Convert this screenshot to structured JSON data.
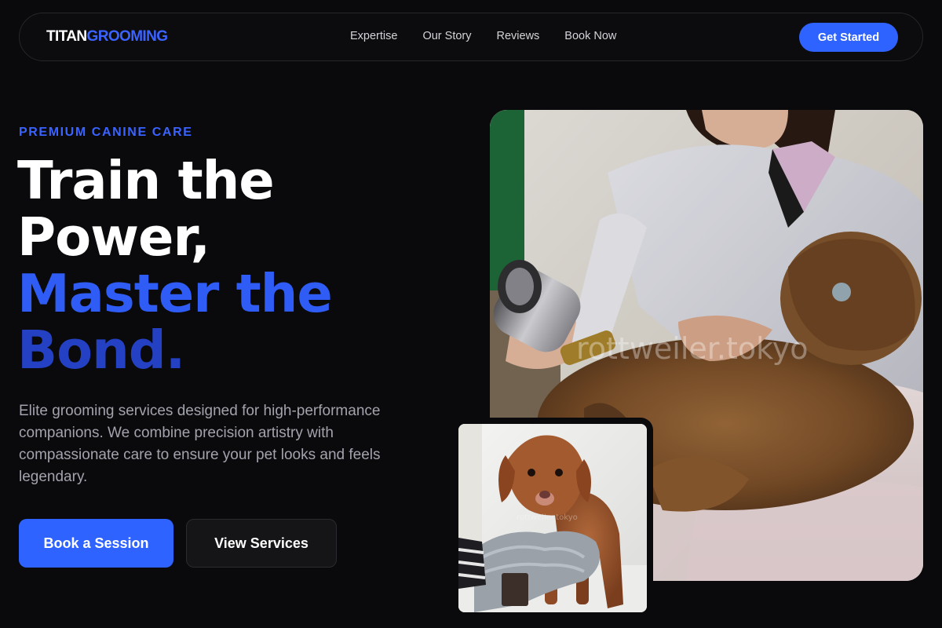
{
  "nav": {
    "logo_part1": "TITAN",
    "logo_part2": "GROOMING",
    "links": [
      "Expertise",
      "Our Story",
      "Reviews",
      "Book Now"
    ],
    "cta_label": "Get Started"
  },
  "hero": {
    "eyebrow": "PREMIUM CANINE CARE",
    "headline": [
      "Train the",
      "Power,",
      "Master the",
      "Bond."
    ],
    "description": "Elite grooming services designed for high-performance companions. We combine precision artistry with compassionate care to ensure your pet looks and feels legendary.",
    "primary_button": "Book a Session",
    "secondary_button": "View Services"
  },
  "images": {
    "main_watermark": "rottweiler.tokyo",
    "inset_watermark": "rottweiler.tokyo"
  },
  "colors": {
    "accent": "#2f63ff",
    "background": "#0a0a0c",
    "headline_blue_light": "#2f5cf5",
    "headline_blue_dark": "#2441c4"
  }
}
